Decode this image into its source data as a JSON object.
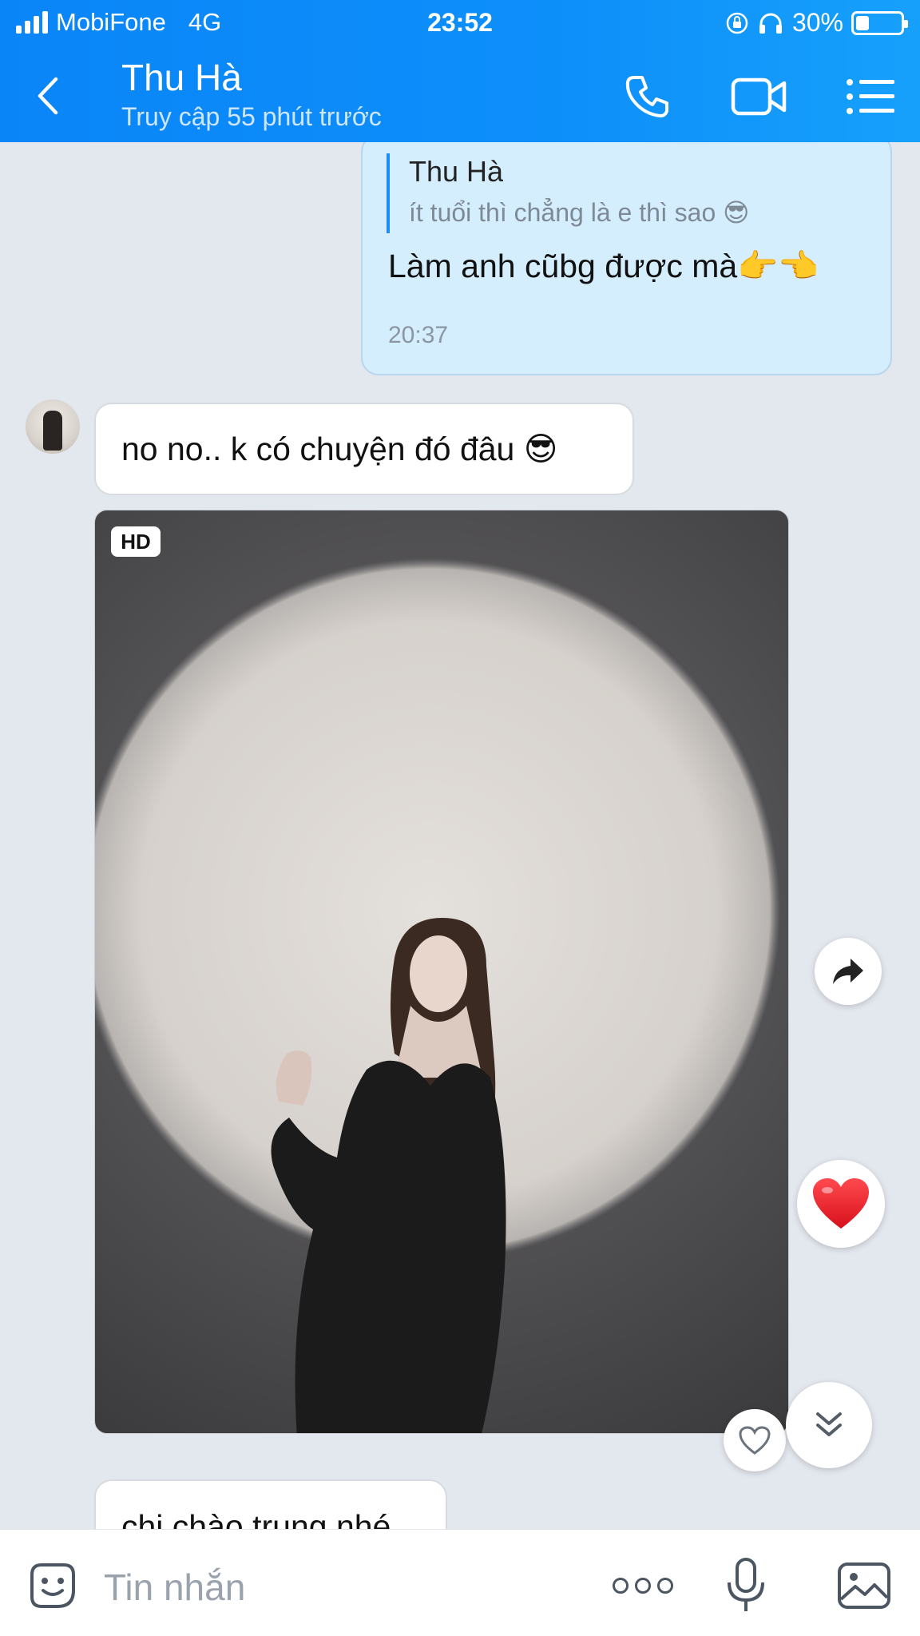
{
  "status_bar": {
    "carrier": "MobiFone",
    "network": "4G",
    "time": "23:52",
    "battery_percent": "30%",
    "battery_level": 0.3
  },
  "header": {
    "contact_name": "Thu Hà",
    "contact_status": "Truy cập 55 phút trước",
    "icons": [
      "back-icon",
      "phone-icon",
      "video-call-icon",
      "menu-list-icon"
    ]
  },
  "messages": {
    "outgoing": {
      "quote_author": "Thu Hà",
      "quote_text": "ít tuổi thì chẳng là e thì sao 😎",
      "text": "Làm anh cũbg được mà👉👈",
      "time": "20:37"
    },
    "incoming_1": {
      "text": "no no.. k có chuyện đó đâu 😎"
    },
    "photo": {
      "badge": "HD"
    },
    "incoming_2": {
      "text": "chị chào trung nhé"
    }
  },
  "floating": {
    "icons": [
      "forward-icon",
      "heart-reaction-icon",
      "heart-outline-icon",
      "scroll-down-icon"
    ]
  },
  "input_bar": {
    "placeholder": "Tin nhắn",
    "icons": [
      "sticker-icon",
      "more-icon",
      "microphone-icon",
      "image-icon"
    ]
  },
  "colors": {
    "header_blue": "#0a85f8",
    "outgoing_bubble": "#d5eefd",
    "incoming_bubble": "#ffffff",
    "background": "#e3e7ee",
    "quote_bar": "#1a8cf4",
    "heart_red": "#e8202a"
  }
}
